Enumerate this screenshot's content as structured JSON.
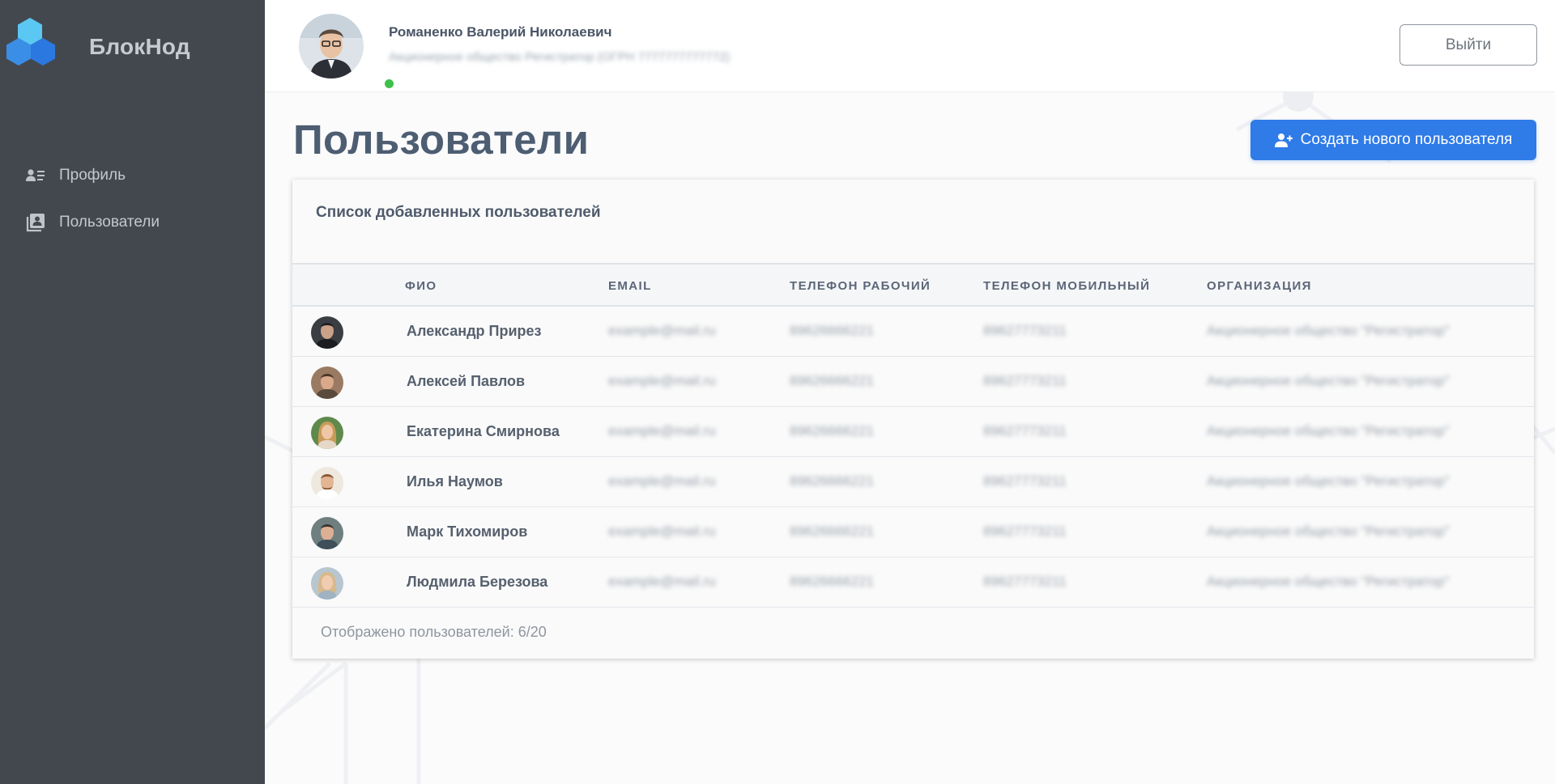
{
  "app": {
    "name": "БлокНод"
  },
  "sidebar": {
    "items": [
      {
        "label": "Профиль",
        "icon": "profile-card-icon"
      },
      {
        "label": "Пользователи",
        "icon": "users-list-icon"
      }
    ]
  },
  "header": {
    "user_name": "Романенко Валерий Николаевич",
    "user_org": "Акционерное общество Регистратор (ОГРН 7777777777772)",
    "logout_label": "Выйти",
    "status": "online"
  },
  "page": {
    "title": "Пользователи",
    "create_button_label": "Создать нового пользователя"
  },
  "card": {
    "title": "Список добавленных пользователей",
    "columns": [
      "ФИО",
      "EMAIL",
      "ТЕЛЕФОН РАБОЧИЙ",
      "ТЕЛЕФОН МОБИЛЬНЫЙ",
      "ОРГАНИЗАЦИЯ"
    ],
    "rows": [
      {
        "name": "Александр Прирез",
        "email": "example@mail.ru",
        "work_phone": "89626666221",
        "mobile_phone": "89627773211",
        "organization": "Акционерное общество \"Регистратор\""
      },
      {
        "name": "Алексей Павлов",
        "email": "example@mail.ru",
        "work_phone": "89626666221",
        "mobile_phone": "89627773211",
        "organization": "Акционерное общество \"Регистратор\""
      },
      {
        "name": "Екатерина Смирнова",
        "email": "example@mail.ru",
        "work_phone": "89626666221",
        "mobile_phone": "89627773211",
        "organization": "Акционерное общество \"Регистратор\""
      },
      {
        "name": "Илья Наумов",
        "email": "example@mail.ru",
        "work_phone": "89626666221",
        "mobile_phone": "89627773211",
        "organization": "Акционерное общество \"Регистратор\""
      },
      {
        "name": "Марк Тихомиров",
        "email": "example@mail.ru",
        "work_phone": "89626666221",
        "mobile_phone": "89627773211",
        "organization": "Акционерное общество \"Регистратор\""
      },
      {
        "name": "Людмила Березова",
        "email": "example@mail.ru",
        "work_phone": "89626666221",
        "mobile_phone": "89627773211",
        "organization": "Акционерное общество \"Регистратор\""
      }
    ],
    "footer": "Отображено пользователей: 6/20"
  },
  "colors": {
    "sidebar_bg": "#43484f",
    "accent": "#2f7be8",
    "online": "#3ec14a",
    "logo_light": "#57c4f0",
    "logo_dark": "#2f7be8"
  }
}
